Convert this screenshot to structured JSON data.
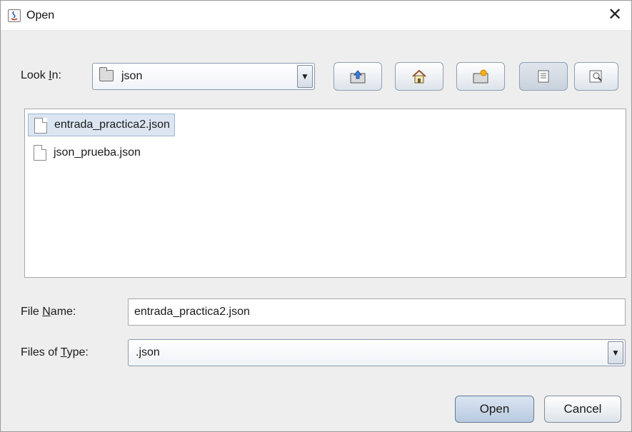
{
  "window": {
    "title": "Open"
  },
  "look_in": {
    "label_pre": "Look ",
    "label_mnemonic": "I",
    "label_post": "n:",
    "value": "json"
  },
  "toolbar": {
    "buttons": [
      {
        "icon": "up-one-level-icon"
      },
      {
        "icon": "home-icon"
      },
      {
        "icon": "new-folder-icon"
      },
      {
        "icon": "list-view-icon"
      },
      {
        "icon": "details-view-icon"
      }
    ]
  },
  "files": [
    {
      "name": "entrada_practica2.json",
      "selected": true
    },
    {
      "name": "json_prueba.json",
      "selected": false
    }
  ],
  "file_name": {
    "label_pre": "File ",
    "label_mnemonic": "N",
    "label_post": "ame:",
    "value": "entrada_practica2.json"
  },
  "files_of_type": {
    "label_pre": "Files of ",
    "label_mnemonic": "T",
    "label_post": "ype:",
    "value": ".json"
  },
  "buttons": {
    "open": "Open",
    "cancel": "Cancel"
  },
  "colors": {
    "dialog_bg": "#eeeeee",
    "selection": "#dce6f2",
    "accent_border": "#8ea0b4"
  }
}
